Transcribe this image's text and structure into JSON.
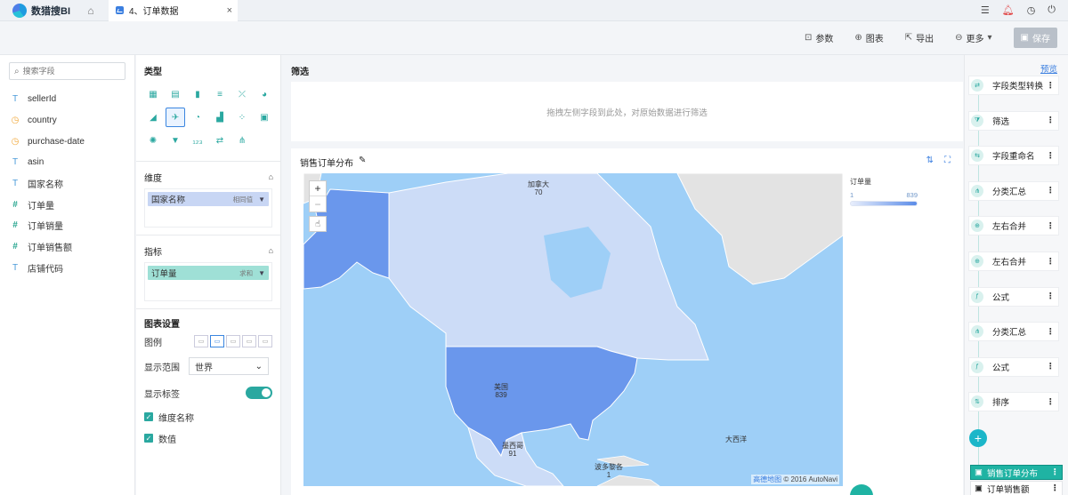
{
  "app": {
    "name": "数猎搜BI"
  },
  "tab": {
    "label": "4、订单数据",
    "close": "×"
  },
  "top_icons": [
    "list-icon",
    "bell-icon",
    "clock-icon",
    "power-icon"
  ],
  "toolbar": {
    "params": "参数",
    "chart": "图表",
    "export": "导出",
    "more": "更多",
    "save": "保存"
  },
  "fields": {
    "search_placeholder": "搜索字段",
    "items": [
      {
        "type": "T",
        "name": "sellerId"
      },
      {
        "type": "◷",
        "name": "country"
      },
      {
        "type": "◷",
        "name": "purchase-date"
      },
      {
        "type": "T",
        "name": "asin"
      },
      {
        "type": "T",
        "name": "国家名称"
      },
      {
        "type": "#",
        "name": "订单量"
      },
      {
        "type": "#",
        "name": "订单销量"
      },
      {
        "type": "#",
        "name": "订单销售额"
      },
      {
        "type": "T",
        "name": "店铺代码"
      }
    ]
  },
  "config": {
    "type_title": "类型",
    "dimension_title": "维度",
    "dimension_pill": {
      "label": "国家名称",
      "sub": "相同值"
    },
    "measure_title": "指标",
    "measure_pill": {
      "label": "订单量",
      "sub": "求和"
    },
    "chart_settings_title": "图表设置",
    "legend_label": "图例",
    "range_label": "显示范围",
    "range_value": "世界",
    "show_labels_label": "显示标签",
    "check_dimension": "维度名称",
    "check_value": "数值"
  },
  "main": {
    "filter_title": "筛选",
    "filter_hint": "拖拽左侧字段到此处，对原始数据进行筛选",
    "chart_title": "销售订单分布",
    "legend_title": "订单量",
    "legend_min": "1",
    "legend_max": "839",
    "credit_brand": "高德地图",
    "credit_text": "© 2016 AutoNavi",
    "ocean_label": "大西洋",
    "regions": [
      {
        "name": "加拿大",
        "value": "70"
      },
      {
        "name": "美国",
        "value": "839"
      },
      {
        "name": "墨西哥",
        "value": "91"
      },
      {
        "name": "波多黎各",
        "value": "1"
      }
    ]
  },
  "steps": {
    "preview": "预览",
    "items": [
      "字段类型转换",
      "筛选",
      "字段重命名",
      "分类汇总",
      "左右合并",
      "左右合并",
      "公式",
      "分类汇总",
      "公式",
      "排序"
    ],
    "results": [
      "销售订单分布",
      "订单销售额"
    ]
  }
}
